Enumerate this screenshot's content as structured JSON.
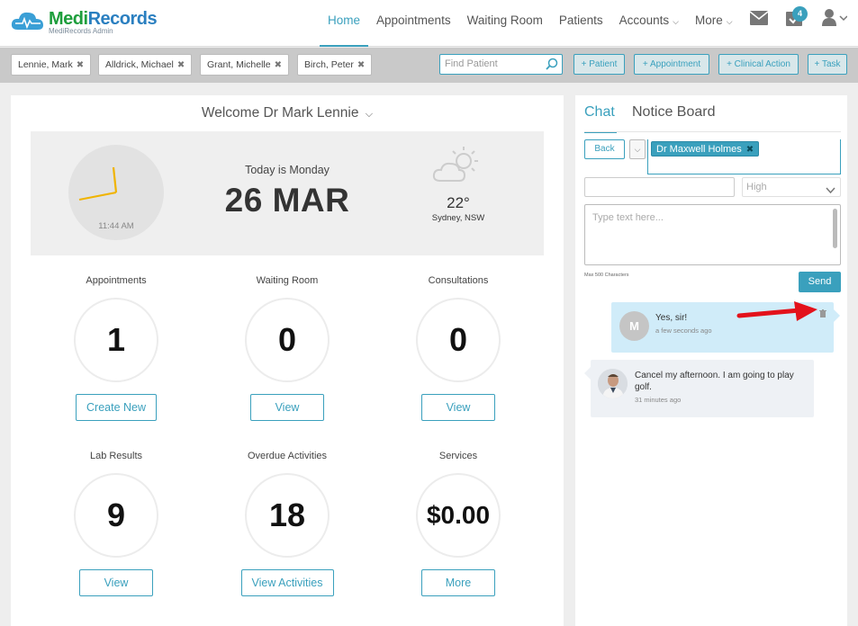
{
  "nav": {
    "logo": {
      "brand_a": "Medi",
      "brand_b": "Records",
      "sub": "MediRecords Admin"
    },
    "items": [
      {
        "label": "Home",
        "active": true,
        "dropdown": false
      },
      {
        "label": "Appointments",
        "active": false,
        "dropdown": false
      },
      {
        "label": "Waiting Room",
        "active": false,
        "dropdown": false
      },
      {
        "label": "Patients",
        "active": false,
        "dropdown": false
      },
      {
        "label": "Accounts",
        "active": false,
        "dropdown": true
      },
      {
        "label": "More",
        "active": false,
        "dropdown": true
      }
    ],
    "icons": [
      "mail-icon",
      "tasks-icon",
      "user-icon"
    ],
    "task_badge": "4"
  },
  "patient_tabs": [
    {
      "label": "Lennie, Mark"
    },
    {
      "label": "Alldrick, Michael"
    },
    {
      "label": "Grant, Michelle"
    },
    {
      "label": "Birch, Peter"
    }
  ],
  "find_patient": {
    "placeholder": "Find Patient"
  },
  "actions": {
    "patient": "+ Patient",
    "appointment": "+ Appointment",
    "clinical": "+ Clinical Action",
    "task": "+ Task"
  },
  "dashboard": {
    "welcome": "Welcome Dr Mark Lennie",
    "clock_time": "11:44 AM",
    "today": "Today is Monday",
    "date": "26 MAR",
    "temperature": "22°",
    "location": "Sydney, NSW",
    "stats": [
      {
        "label": "Appointments",
        "value": "1",
        "button": "Create New"
      },
      {
        "label": "Waiting Room",
        "value": "0",
        "button": "View"
      },
      {
        "label": "Consultations",
        "value": "0",
        "button": "View"
      },
      {
        "label": "Lab Results",
        "value": "9",
        "button": "View"
      },
      {
        "label": "Overdue Activities",
        "value": "18",
        "button": "View Activities"
      },
      {
        "label": "Services",
        "value": "$0.00",
        "button": "More"
      }
    ]
  },
  "chat": {
    "tabs": [
      "Chat",
      "Notice Board"
    ],
    "back": "Back",
    "recipient": "Dr Maxwell Holmes",
    "priority": "High",
    "message_placeholder": "Type text here...",
    "max_chars": "Max 500 Characters",
    "send": "Send",
    "messages": [
      {
        "avatar": "M",
        "text": "Yes, sir!",
        "time": "a few seconds ago"
      },
      {
        "text": "Cancel my afternoon. I am going to play golf.",
        "time": "31 minutes ago"
      }
    ]
  },
  "colors": {
    "accent": "#3aa0bd",
    "annotation_arrow": "#e3121b"
  }
}
